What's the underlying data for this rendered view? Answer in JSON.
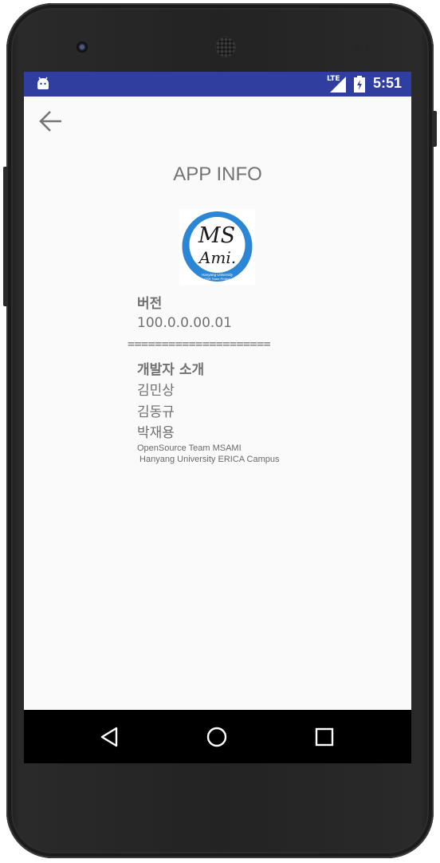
{
  "status_bar": {
    "network": "LTE",
    "time": "5:51"
  },
  "header": {
    "title": "APP INFO"
  },
  "logo": {
    "main_text_line1": "MS",
    "main_text_line2": "Ami.",
    "ring_text_line1": "Hanyang University",
    "ring_text_line2": "OSS Team Project",
    "colors": {
      "ring": "#2b86d6",
      "inner": "#ffffff",
      "ink": "#1a1a1a"
    }
  },
  "info": {
    "version_label": "버전",
    "version_value": "100.0.0.00.01",
    "divider": "=====================",
    "developers_label": "개발자 소개",
    "developers": [
      "김민상",
      "김동규",
      "박재용"
    ],
    "team_line1": "OpenSource Team MSAMI",
    "team_line2": " Hanyang University ERICA Campus"
  },
  "nav_bar": {
    "icons": [
      "back-triangle-icon",
      "home-circle-icon",
      "recents-square-icon"
    ]
  },
  "colors": {
    "status_bar": "#303f9f",
    "background": "#fafafa",
    "text": "#707070"
  }
}
